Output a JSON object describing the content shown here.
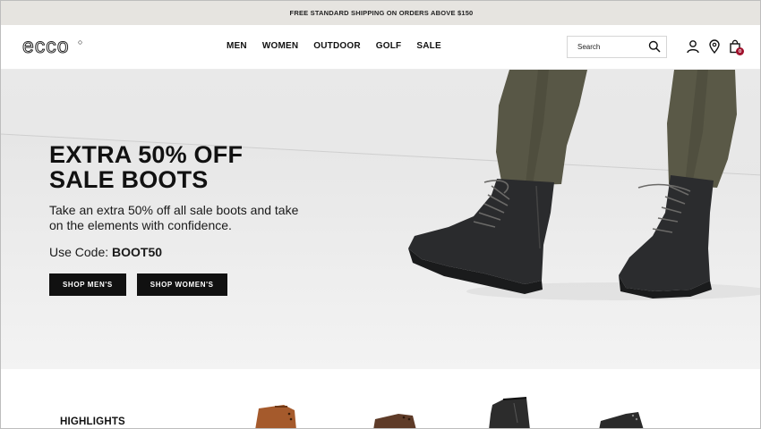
{
  "promo": {
    "text": "FREE STANDARD SHIPPING ON ORDERS ABOVE $150"
  },
  "header": {
    "brand": "ecco",
    "nav": [
      "MEN",
      "WOMEN",
      "OUTDOOR",
      "GOLF",
      "SALE"
    ],
    "search_placeholder": "Search",
    "cart_count": "0"
  },
  "hero": {
    "headline_line1": "EXTRA 50% OFF",
    "headline_line2": "SALE BOOTS",
    "subtext": "Take an extra 50% off all sale boots and take on the elements with confidence.",
    "code_label": "Use Code: ",
    "code_value": "BOOT50",
    "btn_men": "SHOP MEN'S",
    "btn_women": "SHOP WOMEN'S"
  },
  "highlights": {
    "title": "HIGHLIGHTS"
  },
  "colors": {
    "promo_bg": "#e6e4e0",
    "hero_bg": "#ececec",
    "badge": "#a0122d",
    "button": "#111111"
  }
}
